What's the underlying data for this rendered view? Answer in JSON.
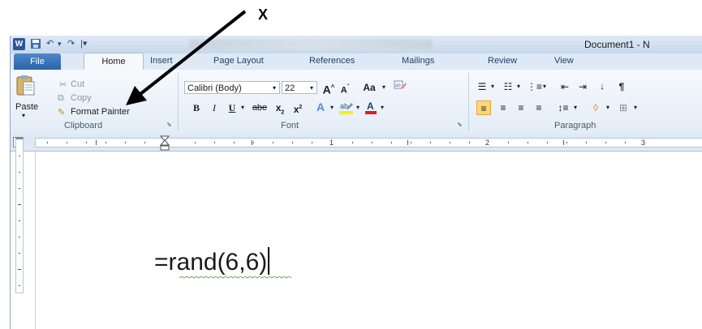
{
  "annotation": {
    "label": "X"
  },
  "window": {
    "document_title": "Document1 - N"
  },
  "quick_access": {
    "word_logo": "W",
    "undo": "↶",
    "redo": "↷",
    "dropdown": "|▾"
  },
  "tabs": [
    {
      "label": "File"
    },
    {
      "label": "Home"
    },
    {
      "label": "Insert"
    },
    {
      "label": "Page Layout"
    },
    {
      "label": "References"
    },
    {
      "label": "Mailings"
    },
    {
      "label": "Review"
    },
    {
      "label": "View"
    }
  ],
  "ribbon": {
    "clipboard": {
      "group_label": "Clipboard",
      "paste": "Paste",
      "cut": "Cut",
      "copy": "Copy",
      "format_painter": "Format Painter"
    },
    "font": {
      "group_label": "Font",
      "font_name": "Calibri (Body)",
      "font_size": "22",
      "grow": "A",
      "shrink": "A",
      "case": "Aa",
      "bold": "B",
      "italic": "I",
      "underline": "U",
      "strike": "abe",
      "subscript": "x",
      "superscript": "x"
    },
    "paragraph": {
      "group_label": "Paragraph"
    }
  },
  "ruler": {
    "marks": [
      "1",
      "2",
      "3"
    ]
  },
  "document": {
    "text": "=rand(6,6)"
  },
  "colors": {
    "accent": "#2b5797",
    "ribbon_bg": "#e3ecf7"
  }
}
